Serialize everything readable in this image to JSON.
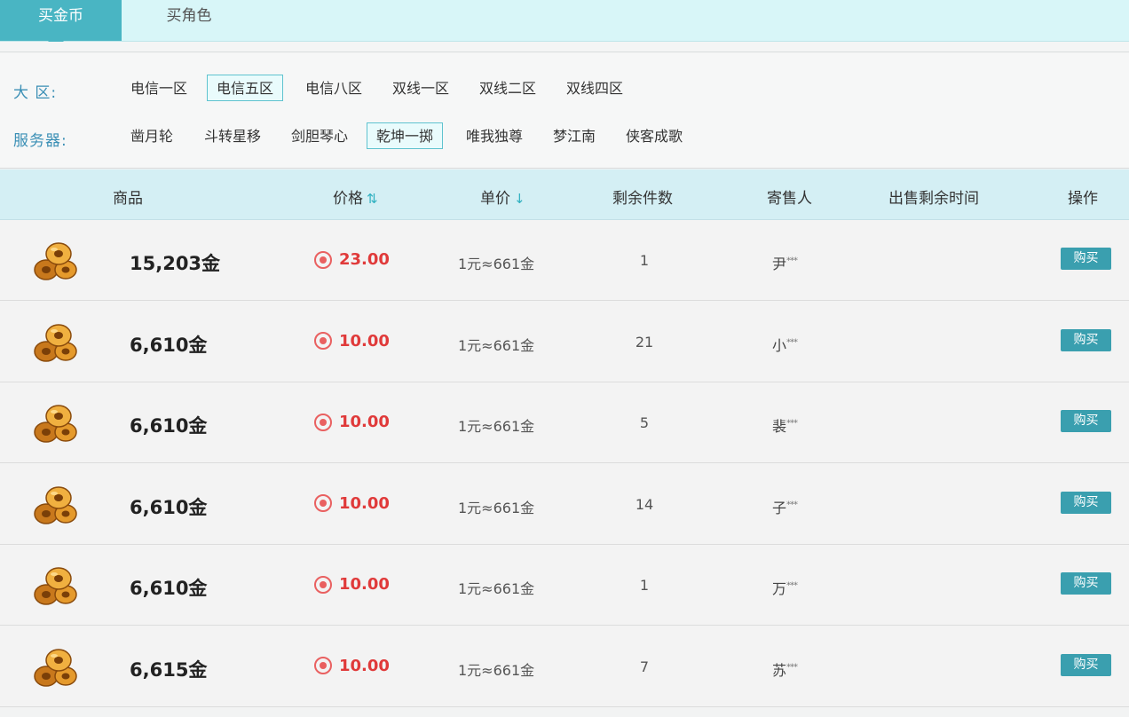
{
  "tabs": [
    {
      "label": "买金币",
      "active": true
    },
    {
      "label": "买角色",
      "active": false
    }
  ],
  "filters": {
    "region_label": "大 区:",
    "regions": [
      "电信一区",
      "电信五区",
      "电信八区",
      "双线一区",
      "双线二区",
      "双线四区"
    ],
    "region_selected": "电信五区",
    "server_label": "服务器:",
    "servers": [
      "凿月轮",
      "斗转星移",
      "剑胆琴心",
      "乾坤一掷",
      "唯我独尊",
      "梦江南",
      "侠客成歌"
    ],
    "server_selected": "乾坤一掷"
  },
  "table": {
    "headers": {
      "item": "商品",
      "price": "价格",
      "unit_price": "单价",
      "remaining": "剩余件数",
      "seller": "寄售人",
      "time_left": "出售剩余时间",
      "action": "操作"
    },
    "sort_icons": {
      "price": "sort-both-icon",
      "unit_price": "sort-down-icon"
    },
    "rows": [
      {
        "amount": "15,203金",
        "price": "23.00",
        "unit": "1元≈661金",
        "qty": "1",
        "seller": "尹",
        "seller_mask": "***",
        "action": "购买"
      },
      {
        "amount": "6,610金",
        "price": "10.00",
        "unit": "1元≈661金",
        "qty": "21",
        "seller": "小",
        "seller_mask": "***",
        "action": "购买"
      },
      {
        "amount": "6,610金",
        "price": "10.00",
        "unit": "1元≈661金",
        "qty": "5",
        "seller": "裴",
        "seller_mask": "***",
        "action": "购买"
      },
      {
        "amount": "6,610金",
        "price": "10.00",
        "unit": "1元≈661金",
        "qty": "14",
        "seller": "子",
        "seller_mask": "***",
        "action": "购买"
      },
      {
        "amount": "6,610金",
        "price": "10.00",
        "unit": "1元≈661金",
        "qty": "1",
        "seller": "万",
        "seller_mask": "***",
        "action": "购买"
      },
      {
        "amount": "6,615金",
        "price": "10.00",
        "unit": "1元≈661金",
        "qty": "7",
        "seller": "苏",
        "seller_mask": "***",
        "action": "购买"
      }
    ]
  },
  "colors": {
    "accent": "#49b5c3",
    "price_red": "#e03a3a",
    "buy_button": "#3a9faf"
  }
}
